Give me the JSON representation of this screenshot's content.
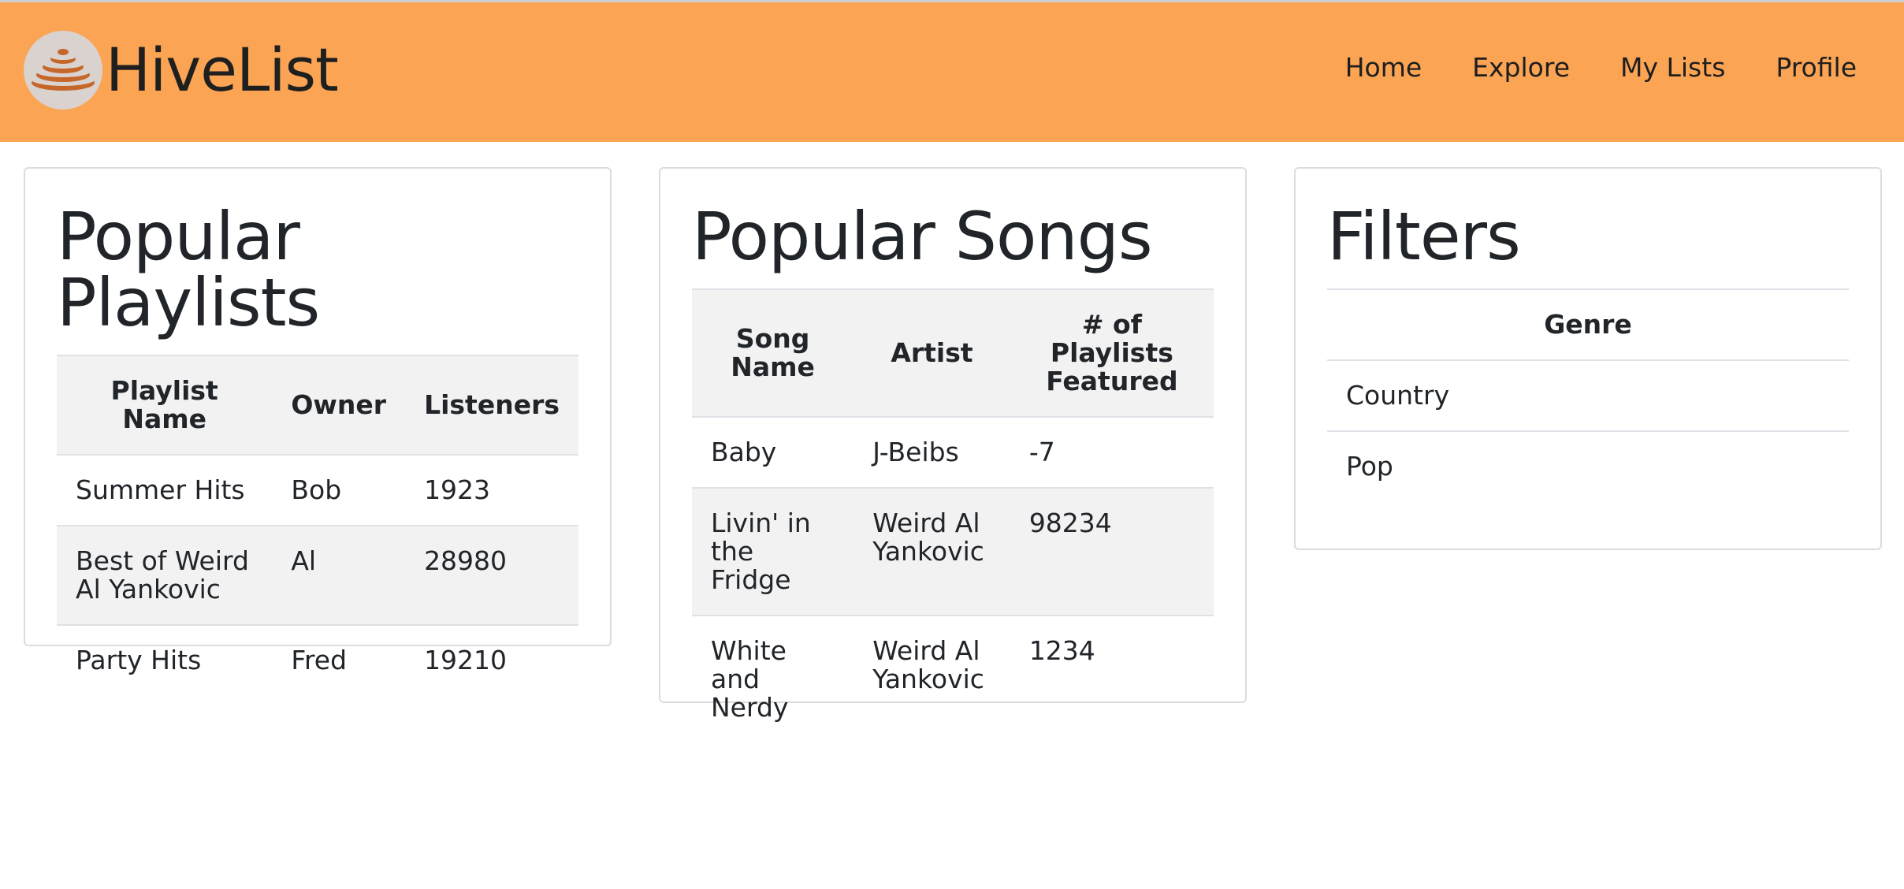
{
  "header": {
    "brand": "HiveList",
    "logo_icon": "beehive-icon",
    "nav": [
      "Home",
      "Explore",
      "My Lists",
      "Profile"
    ],
    "background_color": "#fba454"
  },
  "playlists": {
    "title": "Popular Playlists",
    "columns": [
      "Playlist Name",
      "Owner",
      "Listeners"
    ],
    "rows": [
      [
        "Summer Hits",
        "Bob",
        "1923"
      ],
      [
        "Best of Weird Al Yankovic",
        "Al",
        "28980"
      ],
      [
        "Party Hits",
        "Fred",
        "19210"
      ]
    ]
  },
  "songs": {
    "title": "Popular Songs",
    "columns": [
      "Song Name",
      "Artist",
      "# of Playlists Featured"
    ],
    "rows": [
      [
        "Baby",
        "J-Beibs",
        "-7"
      ],
      [
        "Livin' in the Fridge",
        "Weird Al Yankovic",
        "98234"
      ],
      [
        "White and Nerdy",
        "Weird Al Yankovic",
        "1234"
      ]
    ]
  },
  "filters": {
    "title": "Filters",
    "columns": [
      "Genre"
    ],
    "rows": [
      [
        "Country"
      ],
      [
        "Pop"
      ]
    ]
  }
}
